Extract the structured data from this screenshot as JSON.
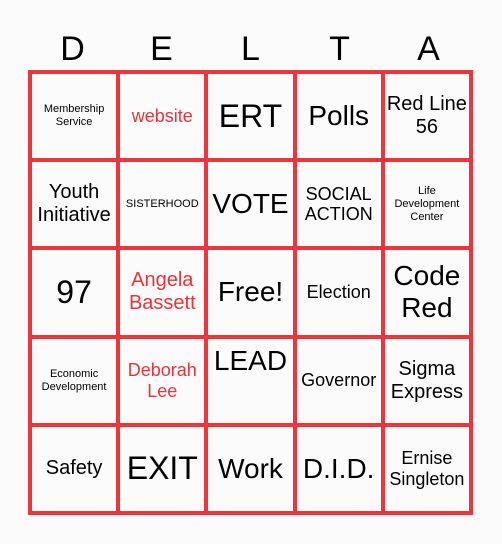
{
  "title_letters": [
    "D",
    "E",
    "L",
    "T",
    "A"
  ],
  "colors": {
    "grid": "#f0343a",
    "highlight_text": "#e8333a",
    "text": "#000000",
    "background": "#fbfbfb"
  },
  "cells": [
    [
      "Membership Service",
      "website",
      "ERT",
      "Polls",
      "Red Line 56"
    ],
    [
      "Youth Initiative",
      "SISTERHOOD",
      "VOTE",
      "SOCIAL ACTION",
      "Life Development Center"
    ],
    [
      "97",
      "Angela Bassett",
      "Free!",
      "Election",
      "Code Red"
    ],
    [
      "Economic Development",
      "Deborah Lee",
      "LEAD",
      "Governor",
      "Sigma Express"
    ],
    [
      "Safety",
      "EXIT",
      "Work",
      "D.I.D.",
      "Ernise Singleton"
    ]
  ]
}
